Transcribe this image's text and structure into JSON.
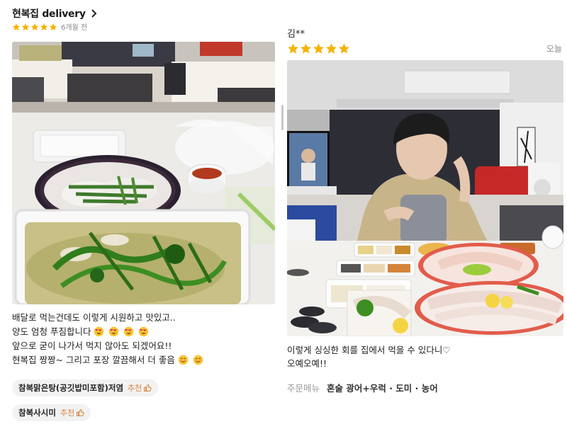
{
  "left_review": {
    "store_name": "현복집 delivery",
    "rating_stars": 5,
    "date": "6개월 전",
    "text_lines": [
      "배달로 먹는건데도 이렇게 시원하고 맛있고..",
      "양도 엄청 푸짐합니다",
      "앞으로 굳이 나가서 먹지 않아도 되겠어요!!",
      "현복집 짱짱~ 그리고 포장 깔끔해서 더 좋음"
    ],
    "menu_tags": [
      {
        "name": "참복맑은탕(공깃밥미포함)저염",
        "recommend_label": "추천"
      },
      {
        "name": "참복사시미",
        "recommend_label": "추천"
      }
    ]
  },
  "right_review": {
    "reviewer_name": "김**",
    "rating_stars": 5,
    "date": "오늘",
    "text_lines": [
      "이렇게 싱싱한 회를 집에서 먹을 수 있다니♡",
      "오예오예!!"
    ],
    "order_menu_label": "주문메뉴",
    "order_menu_value": "혼술 광어+우럭 · 도미 · 농어"
  },
  "colors": {
    "star": "#f5b301",
    "recommend": "#d9823b",
    "chip_bg": "#f2f2f2",
    "muted_text": "#8a8a8a"
  },
  "icons": {
    "store_link": "chevron-right-icon",
    "rating": "star-icon",
    "recommend": "thumbs-up-icon",
    "emoji_heart_eyes": "heart-eyes-emoji-icon",
    "emoji_smile": "smiling-emoji-icon"
  }
}
